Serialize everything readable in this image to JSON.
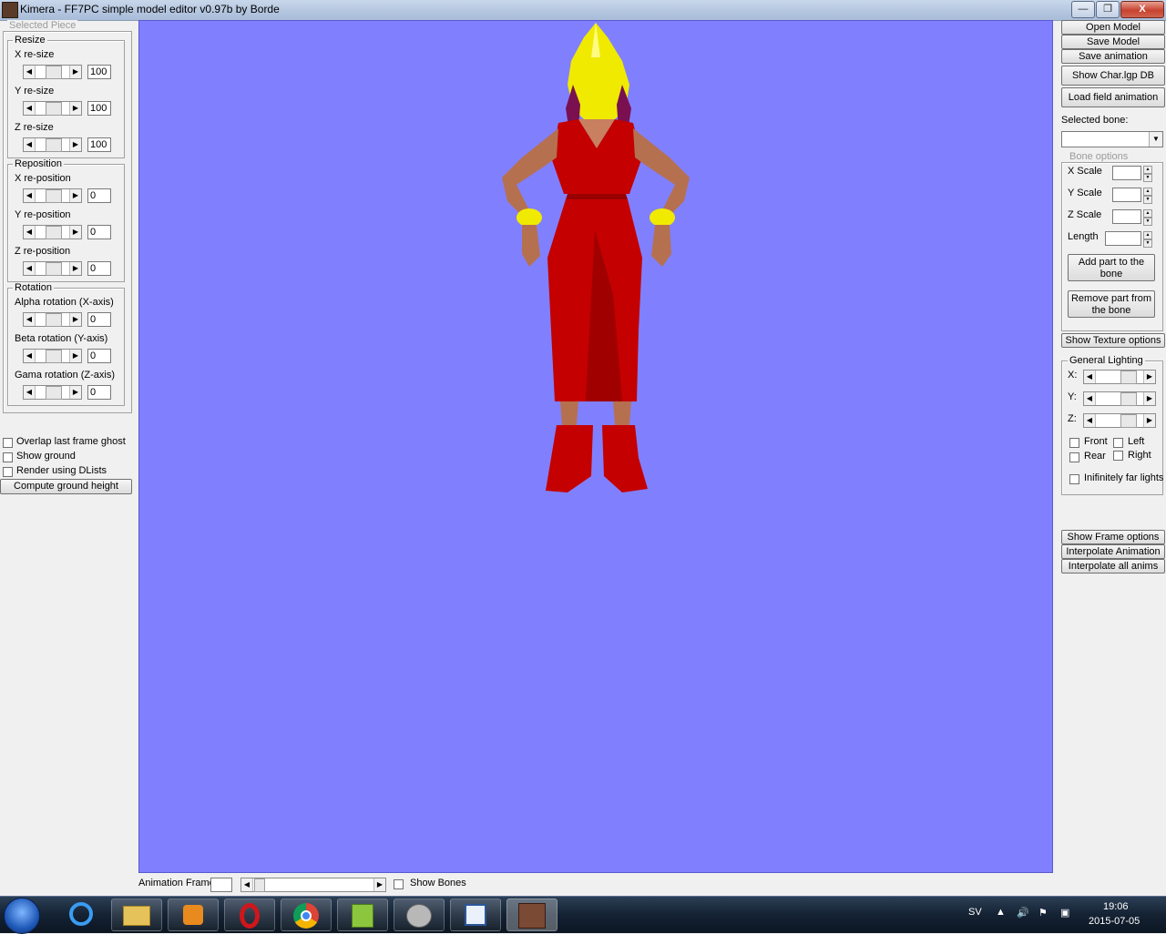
{
  "window": {
    "title": "Kimera - FF7PC simple model editor v0.97b by Borde",
    "controls": {
      "minimize": "—",
      "maximize": "❐",
      "close": "X"
    }
  },
  "left_panel": {
    "group_title": "Selected Piece",
    "resize": {
      "title": "Resize",
      "rows": [
        {
          "label": "X re-size",
          "value": "100"
        },
        {
          "label": "Y re-size",
          "value": "100"
        },
        {
          "label": "Z re-size",
          "value": "100"
        }
      ]
    },
    "reposition": {
      "title": "Reposition",
      "rows": [
        {
          "label": "X re-position",
          "value": "0"
        },
        {
          "label": "Y re-position",
          "value": "0"
        },
        {
          "label": "Z re-position",
          "value": "0"
        }
      ]
    },
    "rotation": {
      "title": "Rotation",
      "rows": [
        {
          "label": "Alpha rotation (X-axis)",
          "value": "0"
        },
        {
          "label": "Beta rotation (Y-axis)",
          "value": "0"
        },
        {
          "label": "Gama rotation (Z-axis)",
          "value": "0"
        }
      ]
    },
    "options": [
      {
        "label": "Overlap last frame ghost",
        "checked": false
      },
      {
        "label": "Show ground",
        "checked": false
      },
      {
        "label": "Render using DLists",
        "checked": false
      }
    ],
    "compute_ground_label": "Compute ground height"
  },
  "right_panel": {
    "buttons_top": [
      "Open Model",
      "Save Model",
      "Save animation",
      "Show Char.lgp DB",
      "Load field animation"
    ],
    "selected_bone_label": "Selected bone:",
    "selected_bone_value": "",
    "bone_options": {
      "title": "Bone options",
      "fields": [
        "X Scale",
        "Y Scale",
        "Z Scale",
        "Length"
      ],
      "add_part": "Add part to the bone",
      "remove_part": "Remove part from the bone"
    },
    "show_texture_options": "Show Texture options",
    "lighting": {
      "title": "General Lighting",
      "axes": [
        "X:",
        "Y:",
        "Z:"
      ],
      "checks": [
        {
          "label": "Front",
          "checked": false
        },
        {
          "label": "Left",
          "checked": false
        },
        {
          "label": "Rear",
          "checked": false
        },
        {
          "label": "Right",
          "checked": false
        }
      ],
      "infinite": "Inifinitely far lights"
    },
    "buttons_bottom": [
      "Show Frame options",
      "Interpolate Animation",
      "Interpolate all anims"
    ]
  },
  "bottom_bar": {
    "animation_frame_label": "Animation Frame",
    "animation_frame_value": "",
    "show_bones_label": "Show Bones"
  },
  "taskbar": {
    "apps": [
      "internet-explorer",
      "file-explorer",
      "media-player",
      "opera",
      "chrome",
      "notepad",
      "download-manager",
      "word",
      "kimera"
    ],
    "language": "SV",
    "time": "19:06",
    "date": "2015-07-05"
  },
  "colors": {
    "viewport": "#8080ff",
    "model_dress": "#c40000",
    "model_hair": "#f0ea00"
  }
}
